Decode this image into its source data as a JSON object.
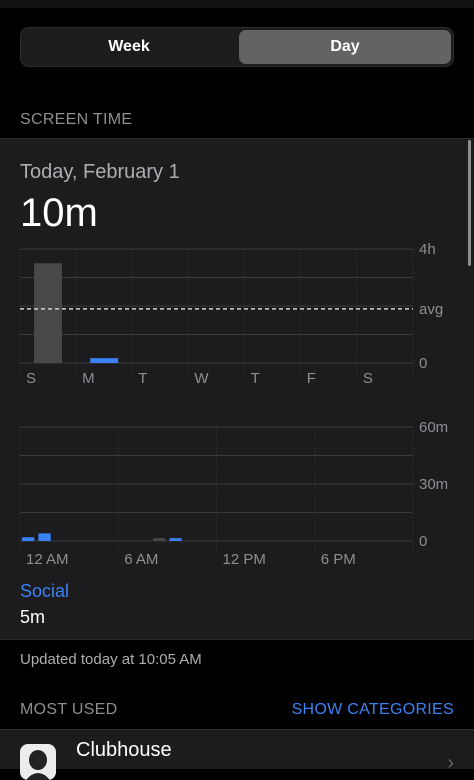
{
  "segment": {
    "week_label": "Week",
    "day_label": "Day",
    "selected": "Day"
  },
  "screen_time": {
    "section_title": "SCREEN TIME",
    "date": "Today, February 1",
    "total": "10m"
  },
  "chart_data": [
    {
      "type": "bar",
      "categories": [
        "S",
        "M",
        "T",
        "W",
        "T",
        "F",
        "S"
      ],
      "values": [
        3.5,
        0.17,
        0,
        0,
        0,
        0,
        0
      ],
      "ylim": [
        0,
        4
      ],
      "yticks": [
        "4h",
        "avg",
        "0"
      ],
      "avg": 1.9,
      "colors": {
        "past": "#48484a",
        "today": "#3a82f6"
      },
      "grid": true
    },
    {
      "type": "bar",
      "x_tick_labels": [
        "12 AM",
        "6 AM",
        "12 PM",
        "6 PM"
      ],
      "yticks": [
        "60m",
        "30m",
        "0"
      ],
      "ylim": [
        0,
        60
      ],
      "hours": [
        0,
        1,
        8,
        9
      ],
      "values": [
        2,
        4,
        1.5,
        1.5
      ],
      "colors": {
        "social": "#3a82f6",
        "other": "#48484a"
      },
      "grid": true
    }
  ],
  "category": {
    "name": "Social",
    "time": "5m"
  },
  "updated": "Updated today at 10:05 AM",
  "most_used": {
    "title": "MOST USED",
    "show_categories": "SHOW CATEGORIES"
  },
  "apps": [
    {
      "name": "Clubhouse"
    }
  ]
}
